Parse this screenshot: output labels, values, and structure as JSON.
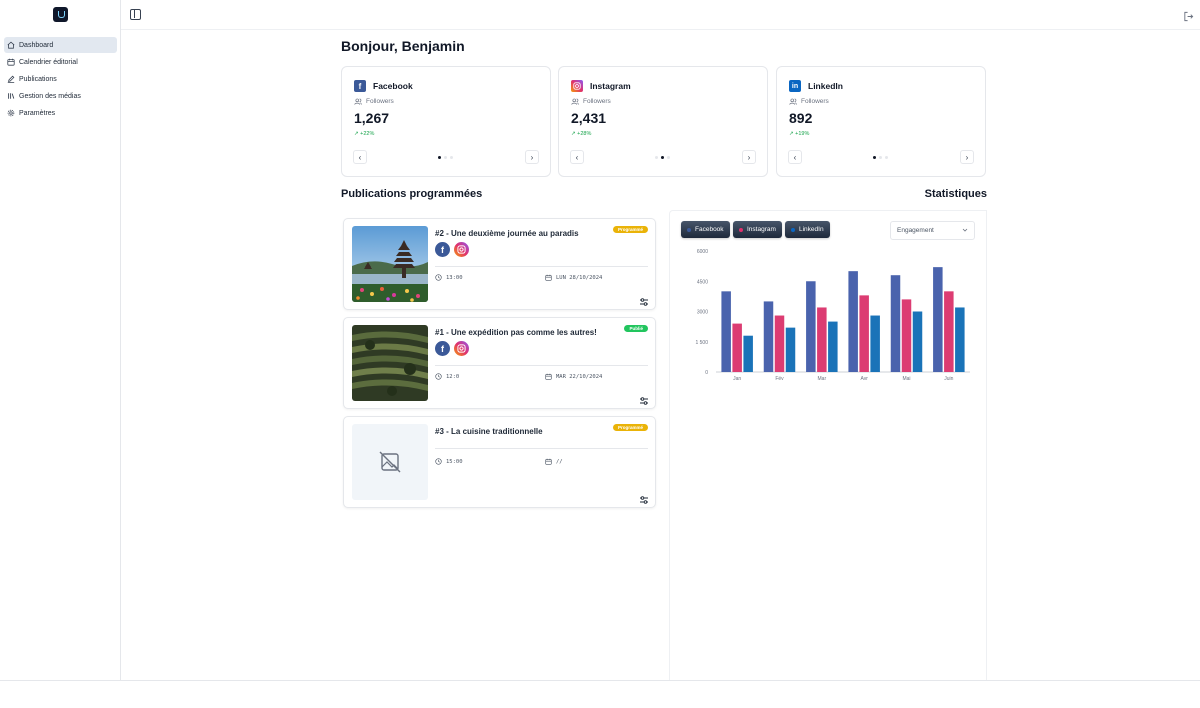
{
  "sidebar": {
    "items": [
      {
        "label": "Dashboard",
        "icon": "home-icon",
        "active": true
      },
      {
        "label": "Calendrier éditorial",
        "icon": "calendar-icon",
        "active": false
      },
      {
        "label": "Publications",
        "icon": "pen-icon",
        "active": false
      },
      {
        "label": "Gestion des médias",
        "icon": "library-icon",
        "active": false
      },
      {
        "label": "Paramètres",
        "icon": "gear-icon",
        "active": false
      }
    ]
  },
  "header": {
    "greeting": "Bonjour, Benjamin"
  },
  "stats": [
    {
      "network": "Facebook",
      "label": "Followers",
      "value": "1,267",
      "growth": "+22%",
      "color": "#3b5998"
    },
    {
      "network": "Instagram",
      "label": "Followers",
      "value": "2,431",
      "growth": "+28%",
      "color": "#e1306c"
    },
    {
      "network": "LinkedIn",
      "label": "Followers",
      "value": "892",
      "growth": "+19%",
      "color": "#0a66c2"
    }
  ],
  "sections": {
    "posts_title": "Publications programmées",
    "stats_title": "Statistiques"
  },
  "posts": [
    {
      "title": "#2 - Une deuxième journée au paradis",
      "status": "Programmé",
      "status_color": "#eab308",
      "time": "13:00",
      "date": "LUN 28/10/2024",
      "image": "temple-photo"
    },
    {
      "title": "#1 - Une expédition pas comme les autres!",
      "status": "Publié",
      "status_color": "#22c55e",
      "time": "12:0",
      "date": "MAR 22/10/2024",
      "image": "rice-terrace-photo"
    },
    {
      "title": "#3 - La cuisine traditionnelle",
      "status": "Programmé",
      "status_color": "#eab308",
      "time": "15:00",
      "date": "//",
      "image": "no-image-placeholder"
    }
  ],
  "filters": [
    {
      "label": "Facebook",
      "color": "#3b5998"
    },
    {
      "label": "Instagram",
      "color": "#e1306c"
    },
    {
      "label": "LinkedIn",
      "color": "#0a66c2"
    }
  ],
  "metric_select": {
    "value": "Engagement"
  },
  "chart_data": {
    "type": "bar",
    "categories": [
      "Jan",
      "Fév",
      "Mar",
      "Avr",
      "Mai",
      "Juin"
    ],
    "series": [
      {
        "values": [
          4000,
          3500,
          4500,
          5000,
          4800,
          5200
        ],
        "color": "#4a63ad"
      },
      {
        "values": [
          2400,
          2800,
          3200,
          3800,
          3600,
          4000
        ],
        "color": "#dc3c72"
      },
      {
        "values": [
          1800,
          2200,
          2500,
          2800,
          3000,
          3200
        ],
        "color": "#1a73b8"
      }
    ],
    "yticks": [
      "0",
      "1 500",
      "3000",
      "4500",
      "6000"
    ],
    "ylim": [
      0,
      6000
    ]
  }
}
